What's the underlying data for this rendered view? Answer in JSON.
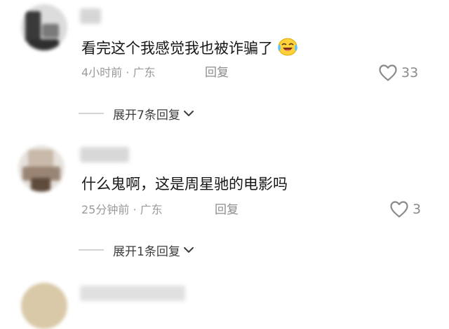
{
  "comments": [
    {
      "text": "看完这个我感觉我也被诈骗了",
      "emoji": "laughing-crying-emoji",
      "meta": "4小时前 · 广东",
      "reply_label": "回复",
      "likes": "33",
      "expand_label": "展开7条回复"
    },
    {
      "text": "什么鬼啊，这是周星驰的电影吗",
      "meta": "25分钟前 · 广东",
      "reply_label": "回复",
      "likes": "3",
      "expand_label": "展开1条回复"
    }
  ],
  "icons": {
    "like": "heart-outline-icon",
    "expand": "chevron-down-icon"
  },
  "colors": {
    "text": "#161616",
    "meta": "#9a9a9a",
    "divider": "#d4d4d4"
  }
}
